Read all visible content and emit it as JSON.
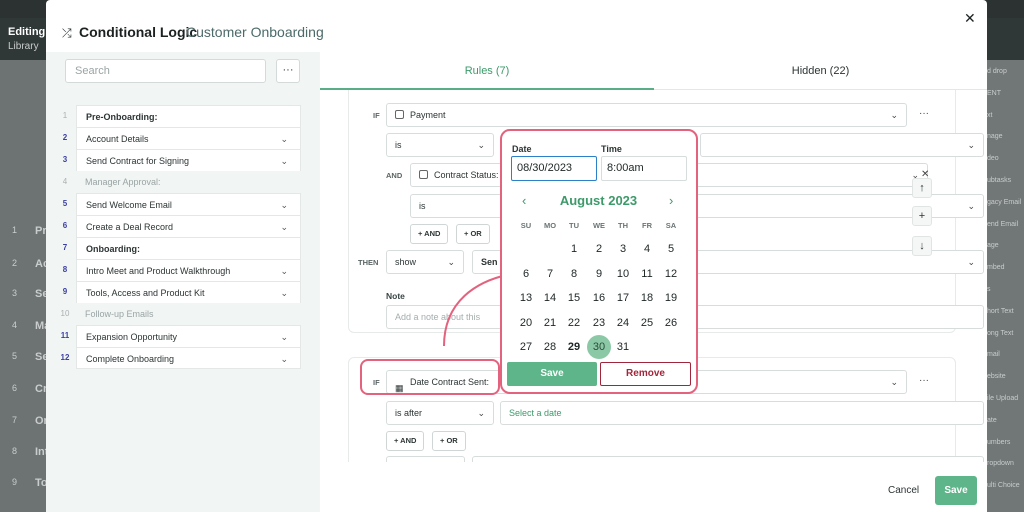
{
  "background": {
    "editing_label": "Editing",
    "library_label": "Library",
    "left_items": [
      "Pr",
      "Ac",
      "Se",
      "Ma",
      "Se",
      "Cr",
      "Or",
      "Int",
      "To"
    ],
    "left_nums": [
      "1",
      "2",
      "3",
      "4",
      "5",
      "6",
      "7",
      "8",
      "9"
    ],
    "right_items": [
      "d drop",
      "ENT",
      "xt",
      "nage",
      "deo",
      "ubtasks",
      "gacy Email",
      "end Email",
      "age",
      "mbed",
      "s",
      "hort Text",
      "ong Text",
      "mail",
      "ebsite",
      "ile Upload",
      "ate",
      "umbers",
      "ropdown",
      "ulti Choice"
    ]
  },
  "header": {
    "title": "Conditional Logic",
    "subtitle": "Customer Onboarding",
    "shuffle_icon": "shuffle-icon",
    "close_icon": "close-icon"
  },
  "sidebar": {
    "search_placeholder": "Search",
    "more_label": "···",
    "items": [
      {
        "num": "1",
        "label": "Pre-Onboarding:",
        "type": "head",
        "dim_num": true
      },
      {
        "num": "2",
        "label": "Account Details",
        "type": "item"
      },
      {
        "num": "3",
        "label": "Send Contract for Signing",
        "type": "item"
      },
      {
        "num": "4",
        "label": "Manager Approval:",
        "type": "dim",
        "dim_num": true
      },
      {
        "num": "5",
        "label": "Send Welcome Email",
        "type": "item"
      },
      {
        "num": "6",
        "label": "Create a Deal Record",
        "type": "item"
      },
      {
        "num": "7",
        "label": "Onboarding:",
        "type": "head"
      },
      {
        "num": "8",
        "label": "Intro Meet and Product Walkthrough",
        "type": "item"
      },
      {
        "num": "9",
        "label": "Tools, Access and Product Kit",
        "type": "item"
      },
      {
        "num": "10",
        "label": "Follow-up Emails",
        "type": "dim",
        "dim_num": true
      },
      {
        "num": "11",
        "label": "Expansion Opportunity",
        "type": "item"
      },
      {
        "num": "12",
        "label": "Complete Onboarding",
        "type": "item"
      }
    ]
  },
  "tabs": {
    "rules": "Rules (7)",
    "hidden": "Hidden (22)"
  },
  "rule1": {
    "if_label": "IF",
    "field": "Payment",
    "operator": "is",
    "and_label": "AND",
    "and_field": "Contract Status:",
    "and_operator": "is",
    "add_and": "+ AND",
    "add_or": "+ OR",
    "then_label": "THEN",
    "action": "show",
    "target": "Sen",
    "note_label": "Note",
    "note_placeholder": "Add a note about this"
  },
  "rule2": {
    "if_label": "IF",
    "field": "Date Contract Sent:",
    "operator": "is after",
    "value_placeholder": "Select a date",
    "add_and": "+ AND",
    "add_or": "+ OR"
  },
  "side_buttons": [
    "↑",
    "+",
    "↓"
  ],
  "datepicker": {
    "date_label": "Date",
    "time_label": "Time",
    "date_value": "08/30/2023",
    "time_value": "8:00am",
    "month": "August 2023",
    "weekdays": [
      "SU",
      "MO",
      "TU",
      "WE",
      "TH",
      "FR",
      "SA"
    ],
    "first_weekday": 2,
    "days_in_month": 31,
    "bold_day": 29,
    "selected_day": 30,
    "save_label": "Save",
    "remove_label": "Remove"
  },
  "footer": {
    "cancel": "Cancel",
    "save": "Save"
  },
  "colors": {
    "accent": "#5db589",
    "highlight": "#e3627d",
    "remove": "#a0263c"
  }
}
